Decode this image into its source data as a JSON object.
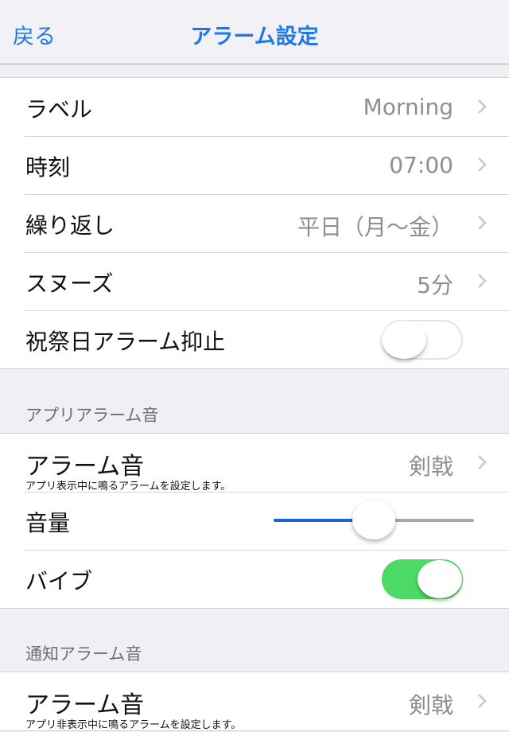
{
  "navbar": {
    "back_label": "戻る",
    "title": "アラーム設定"
  },
  "colors": {
    "accent": "#1f78e6",
    "toggle_on": "#4cd964",
    "slider_fill": "#1a64e0"
  },
  "general": {
    "rows": [
      {
        "label": "ラベル",
        "value": "Morning"
      },
      {
        "label": "時刻",
        "value": "07:00"
      },
      {
        "label": "繰り返し",
        "value": "平日（月〜金）"
      },
      {
        "label": "スヌーズ",
        "value": "5分"
      }
    ],
    "holiday_toggle": {
      "label": "祝祭日アラーム抑止",
      "on": false
    }
  },
  "app_alarm": {
    "header": "アプリアラーム音",
    "sound": {
      "label": "アラーム音",
      "sublabel": "アプリ表示中に鳴るアラームを設定します。",
      "value": "剣戟"
    },
    "volume": {
      "label": "音量",
      "value_percent": 50
    },
    "vibrate": {
      "label": "バイブ",
      "on": true
    }
  },
  "notify_alarm": {
    "header": "通知アラーム音",
    "sound": {
      "label": "アラーム音",
      "sublabel": "アプリ非表示中に鳴るアラームを設定します。",
      "value": "剣戟"
    }
  }
}
